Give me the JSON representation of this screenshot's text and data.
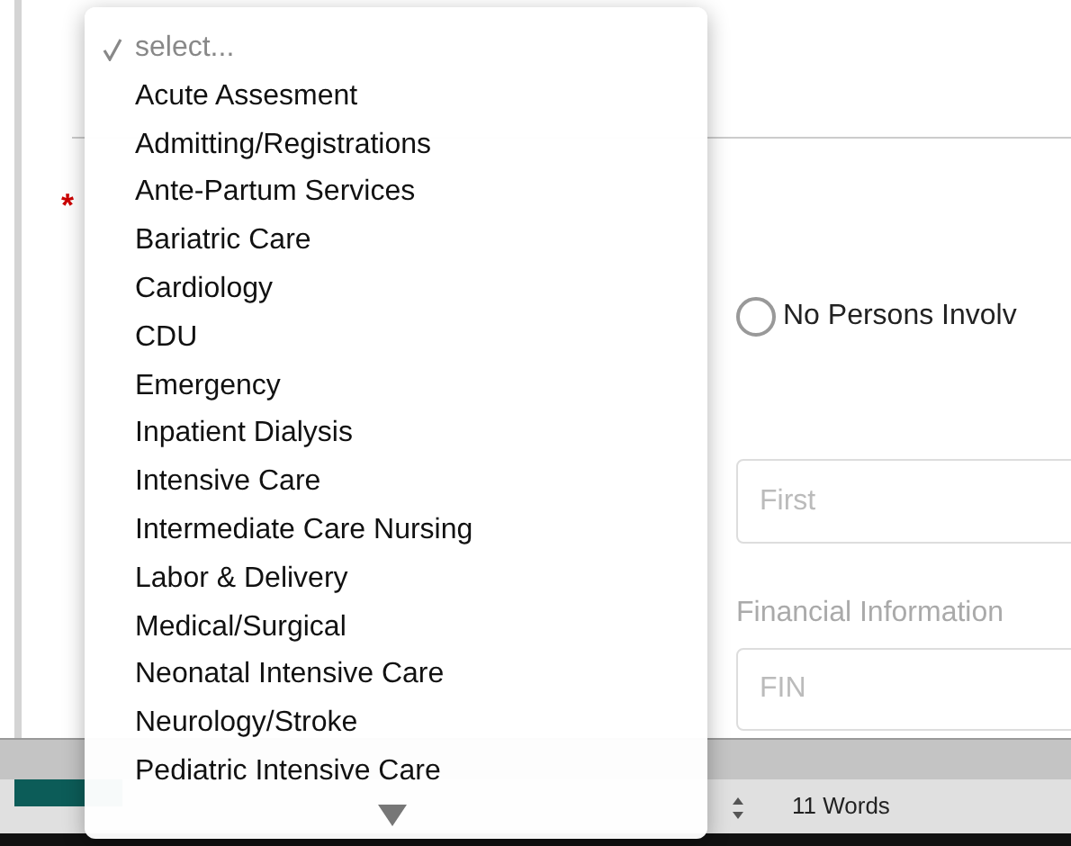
{
  "form": {
    "required_mark": "*",
    "radio": {
      "label": "No Persons Involv",
      "selected": false
    },
    "name_field": {
      "placeholder": "First"
    },
    "financial": {
      "label": "Financial Information",
      "placeholder": "FIN"
    }
  },
  "status_bar": {
    "word_count": "11 Words"
  },
  "dropdown": {
    "items": [
      {
        "label": "select...",
        "kind": "placeholder",
        "selected": true
      },
      {
        "label": "Acute Assesment",
        "kind": "option",
        "selected": false
      },
      {
        "label": "Admitting/Registrations",
        "kind": "option",
        "selected": false
      },
      {
        "label": "Ante-Partum Services",
        "kind": "option",
        "selected": false
      },
      {
        "label": "Bariatric Care",
        "kind": "option",
        "selected": false
      },
      {
        "label": "Cardiology",
        "kind": "option",
        "selected": false
      },
      {
        "label": "CDU",
        "kind": "option",
        "selected": false
      },
      {
        "label": "Emergency",
        "kind": "option",
        "selected": false
      },
      {
        "label": "Inpatient Dialysis",
        "kind": "option",
        "selected": false
      },
      {
        "label": "Intensive Care",
        "kind": "option",
        "selected": false
      },
      {
        "label": "Intermediate Care Nursing",
        "kind": "option",
        "selected": false
      },
      {
        "label": "Labor & Delivery",
        "kind": "option",
        "selected": false
      },
      {
        "label": "Medical/Surgical",
        "kind": "option",
        "selected": false
      },
      {
        "label": "Neonatal Intensive Care",
        "kind": "option",
        "selected": false
      },
      {
        "label": "Neurology/Stroke",
        "kind": "option",
        "selected": false
      },
      {
        "label": "Pediatric Intensive Care",
        "kind": "option",
        "selected": false
      }
    ]
  }
}
